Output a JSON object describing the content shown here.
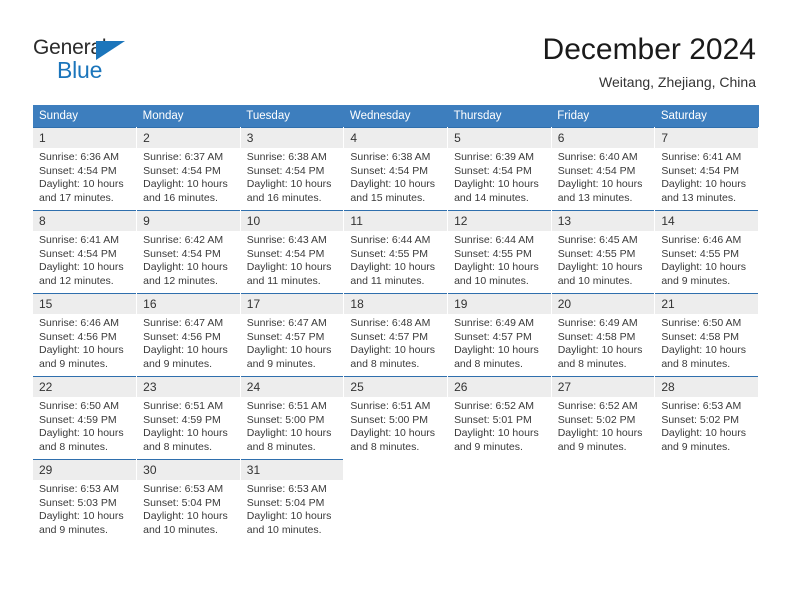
{
  "brand": {
    "name_part1": "General",
    "name_part2": "Blue",
    "accent_color": "#1b75bb",
    "triangle_icon": "logo-triangle-icon"
  },
  "header": {
    "title": "December 2024",
    "location": "Weitang, Zhejiang, China"
  },
  "calendar": {
    "header_color": "#3d7ebe",
    "weekdays": [
      "Sunday",
      "Monday",
      "Tuesday",
      "Wednesday",
      "Thursday",
      "Friday",
      "Saturday"
    ],
    "weeks": [
      [
        {
          "day": "1",
          "sunrise": "Sunrise: 6:36 AM",
          "sunset": "Sunset: 4:54 PM",
          "daylight": "Daylight: 10 hours and 17 minutes."
        },
        {
          "day": "2",
          "sunrise": "Sunrise: 6:37 AM",
          "sunset": "Sunset: 4:54 PM",
          "daylight": "Daylight: 10 hours and 16 minutes."
        },
        {
          "day": "3",
          "sunrise": "Sunrise: 6:38 AM",
          "sunset": "Sunset: 4:54 PM",
          "daylight": "Daylight: 10 hours and 16 minutes."
        },
        {
          "day": "4",
          "sunrise": "Sunrise: 6:38 AM",
          "sunset": "Sunset: 4:54 PM",
          "daylight": "Daylight: 10 hours and 15 minutes."
        },
        {
          "day": "5",
          "sunrise": "Sunrise: 6:39 AM",
          "sunset": "Sunset: 4:54 PM",
          "daylight": "Daylight: 10 hours and 14 minutes."
        },
        {
          "day": "6",
          "sunrise": "Sunrise: 6:40 AM",
          "sunset": "Sunset: 4:54 PM",
          "daylight": "Daylight: 10 hours and 13 minutes."
        },
        {
          "day": "7",
          "sunrise": "Sunrise: 6:41 AM",
          "sunset": "Sunset: 4:54 PM",
          "daylight": "Daylight: 10 hours and 13 minutes."
        }
      ],
      [
        {
          "day": "8",
          "sunrise": "Sunrise: 6:41 AM",
          "sunset": "Sunset: 4:54 PM",
          "daylight": "Daylight: 10 hours and 12 minutes."
        },
        {
          "day": "9",
          "sunrise": "Sunrise: 6:42 AM",
          "sunset": "Sunset: 4:54 PM",
          "daylight": "Daylight: 10 hours and 12 minutes."
        },
        {
          "day": "10",
          "sunrise": "Sunrise: 6:43 AM",
          "sunset": "Sunset: 4:54 PM",
          "daylight": "Daylight: 10 hours and 11 minutes."
        },
        {
          "day": "11",
          "sunrise": "Sunrise: 6:44 AM",
          "sunset": "Sunset: 4:55 PM",
          "daylight": "Daylight: 10 hours and 11 minutes."
        },
        {
          "day": "12",
          "sunrise": "Sunrise: 6:44 AM",
          "sunset": "Sunset: 4:55 PM",
          "daylight": "Daylight: 10 hours and 10 minutes."
        },
        {
          "day": "13",
          "sunrise": "Sunrise: 6:45 AM",
          "sunset": "Sunset: 4:55 PM",
          "daylight": "Daylight: 10 hours and 10 minutes."
        },
        {
          "day": "14",
          "sunrise": "Sunrise: 6:46 AM",
          "sunset": "Sunset: 4:55 PM",
          "daylight": "Daylight: 10 hours and 9 minutes."
        }
      ],
      [
        {
          "day": "15",
          "sunrise": "Sunrise: 6:46 AM",
          "sunset": "Sunset: 4:56 PM",
          "daylight": "Daylight: 10 hours and 9 minutes."
        },
        {
          "day": "16",
          "sunrise": "Sunrise: 6:47 AM",
          "sunset": "Sunset: 4:56 PM",
          "daylight": "Daylight: 10 hours and 9 minutes."
        },
        {
          "day": "17",
          "sunrise": "Sunrise: 6:47 AM",
          "sunset": "Sunset: 4:57 PM",
          "daylight": "Daylight: 10 hours and 9 minutes."
        },
        {
          "day": "18",
          "sunrise": "Sunrise: 6:48 AM",
          "sunset": "Sunset: 4:57 PM",
          "daylight": "Daylight: 10 hours and 8 minutes."
        },
        {
          "day": "19",
          "sunrise": "Sunrise: 6:49 AM",
          "sunset": "Sunset: 4:57 PM",
          "daylight": "Daylight: 10 hours and 8 minutes."
        },
        {
          "day": "20",
          "sunrise": "Sunrise: 6:49 AM",
          "sunset": "Sunset: 4:58 PM",
          "daylight": "Daylight: 10 hours and 8 minutes."
        },
        {
          "day": "21",
          "sunrise": "Sunrise: 6:50 AM",
          "sunset": "Sunset: 4:58 PM",
          "daylight": "Daylight: 10 hours and 8 minutes."
        }
      ],
      [
        {
          "day": "22",
          "sunrise": "Sunrise: 6:50 AM",
          "sunset": "Sunset: 4:59 PM",
          "daylight": "Daylight: 10 hours and 8 minutes."
        },
        {
          "day": "23",
          "sunrise": "Sunrise: 6:51 AM",
          "sunset": "Sunset: 4:59 PM",
          "daylight": "Daylight: 10 hours and 8 minutes."
        },
        {
          "day": "24",
          "sunrise": "Sunrise: 6:51 AM",
          "sunset": "Sunset: 5:00 PM",
          "daylight": "Daylight: 10 hours and 8 minutes."
        },
        {
          "day": "25",
          "sunrise": "Sunrise: 6:51 AM",
          "sunset": "Sunset: 5:00 PM",
          "daylight": "Daylight: 10 hours and 8 minutes."
        },
        {
          "day": "26",
          "sunrise": "Sunrise: 6:52 AM",
          "sunset": "Sunset: 5:01 PM",
          "daylight": "Daylight: 10 hours and 9 minutes."
        },
        {
          "day": "27",
          "sunrise": "Sunrise: 6:52 AM",
          "sunset": "Sunset: 5:02 PM",
          "daylight": "Daylight: 10 hours and 9 minutes."
        },
        {
          "day": "28",
          "sunrise": "Sunrise: 6:53 AM",
          "sunset": "Sunset: 5:02 PM",
          "daylight": "Daylight: 10 hours and 9 minutes."
        }
      ],
      [
        {
          "day": "29",
          "sunrise": "Sunrise: 6:53 AM",
          "sunset": "Sunset: 5:03 PM",
          "daylight": "Daylight: 10 hours and 9 minutes."
        },
        {
          "day": "30",
          "sunrise": "Sunrise: 6:53 AM",
          "sunset": "Sunset: 5:04 PM",
          "daylight": "Daylight: 10 hours and 10 minutes."
        },
        {
          "day": "31",
          "sunrise": "Sunrise: 6:53 AM",
          "sunset": "Sunset: 5:04 PM",
          "daylight": "Daylight: 10 hours and 10 minutes."
        },
        {
          "day": "",
          "sunrise": "",
          "sunset": "",
          "daylight": ""
        },
        {
          "day": "",
          "sunrise": "",
          "sunset": "",
          "daylight": ""
        },
        {
          "day": "",
          "sunrise": "",
          "sunset": "",
          "daylight": ""
        },
        {
          "day": "",
          "sunrise": "",
          "sunset": "",
          "daylight": ""
        }
      ]
    ]
  }
}
